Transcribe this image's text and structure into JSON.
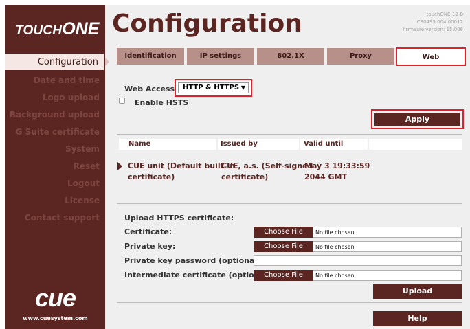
{
  "brand": {
    "logo_top": "TOUCH",
    "logo_top_big": "ONE",
    "logo_bottom": "cue",
    "url": "www.cuesystem.com",
    "colors": {
      "primary": "#5b2622",
      "tab": "#b7908a",
      "highlight": "#e0202a",
      "active_nav_bg": "#f4e7e4"
    }
  },
  "page": {
    "title": "Configuration"
  },
  "device_info": {
    "line1": "touchONE-12-B",
    "line2": "CS0495.004.00012",
    "line3": "firmware version: 15.006"
  },
  "sidebar": {
    "items": [
      {
        "label": "Configuration"
      },
      {
        "label": "Date and time"
      },
      {
        "label": "Logo upload"
      },
      {
        "label": "Background upload"
      },
      {
        "label": "G Suite certificate"
      },
      {
        "label": "System"
      },
      {
        "label": "Reset"
      },
      {
        "label": "Logout"
      },
      {
        "label": "License"
      },
      {
        "label": "Contact support"
      }
    ]
  },
  "tabs": [
    {
      "label": "Identification"
    },
    {
      "label": "IP settings"
    },
    {
      "label": "802.1X"
    },
    {
      "label": "Proxy"
    },
    {
      "label": "Web"
    }
  ],
  "web_access": {
    "label": "Web Access:",
    "selected": "HTTP & HTTPS",
    "arrow_icon": "chevron-down-icon",
    "hsts_label": "Enable HSTS",
    "hsts_checked": false
  },
  "apply_label": "Apply",
  "cert_table": {
    "headers": [
      "Name",
      "Issued by",
      "Valid until",
      ""
    ],
    "row": {
      "name_line1": "CUE unit (Default built-in",
      "name_line2": "certificate)",
      "issued_line1": "CUE, a.s. (Self-signed",
      "issued_line2": "certificate)",
      "valid_line1": "May 3 19:33:59",
      "valid_line2": "2044 GMT"
    }
  },
  "upload": {
    "title": "Upload HTTPS certificate:",
    "certificate_label": "Certificate:",
    "private_key_label": "Private key:",
    "password_label": "Private key password (optional):",
    "intermediate_label": "Intermediate certificate (optional):",
    "choose_file": "Choose File",
    "no_file": "No file chosen",
    "upload_button": "Upload",
    "help_button": "Help"
  }
}
